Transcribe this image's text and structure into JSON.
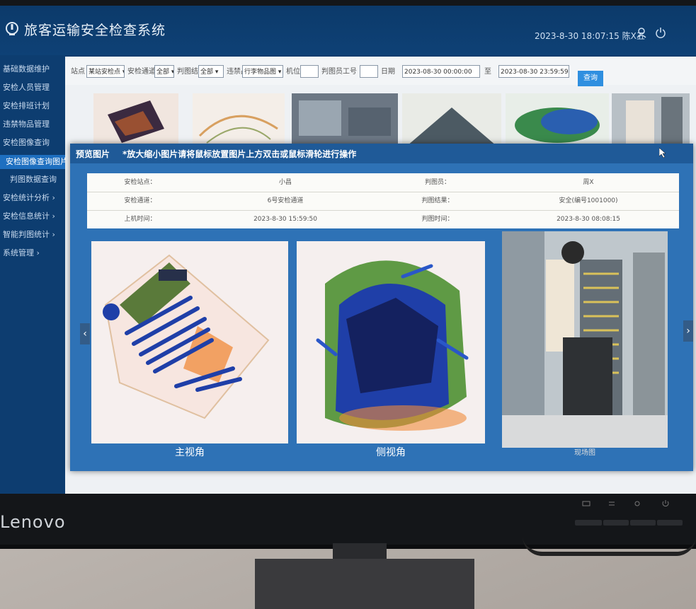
{
  "app": {
    "title": "旅客运输安全检查系统",
    "datetime": "2023-8-30 18:07:15",
    "user": "陈X五"
  },
  "sidebar": {
    "items": [
      {
        "label": "基础数据维护",
        "active": false
      },
      {
        "label": "安检人员管理",
        "active": false
      },
      {
        "label": "安检排班计划",
        "active": false
      },
      {
        "label": "违禁物品管理",
        "active": false
      },
      {
        "label": "安检图像查询",
        "active": false
      },
      {
        "label": "安检图像查询图片",
        "active": true
      },
      {
        "label": "判图数据查询",
        "active": false
      },
      {
        "label": "安检统计分析 ›",
        "active": false
      },
      {
        "label": "安检信息统计 ›",
        "active": false
      },
      {
        "label": "智能判图统计 ›",
        "active": false
      },
      {
        "label": "系统管理 ›",
        "active": false
      }
    ]
  },
  "filters": {
    "f1_label": "站点",
    "f1_value": "某站安检点 ▾",
    "f2_label": "安检通道",
    "f2_value": "全部 ▾",
    "f3_label": "判图结果",
    "f3_value": "全部 ▾",
    "f4_label": "违禁品",
    "f4_value": "行李物品图 ▾",
    "f5_label": "机位",
    "f6_label": "判图员工号",
    "f7_label": "日期",
    "start_date": "2023-08-30 00:00:00",
    "to_label": "至",
    "end_date": "2023-08-30 23:59:59",
    "search_label": "查询"
  },
  "modal": {
    "title": "预览图片",
    "hint": "*放大缩小图片请将鼠标放置图片上方双击或鼠标滑轮进行操作",
    "info_rows": [
      [
        "安检站点：",
        "小昌",
        "判图员：",
        "周X"
      ],
      [
        "安检通道：",
        "6号安检通道",
        "判图结果：",
        "安全(编号1001000)"
      ],
      [
        "上机时间：",
        "2023-8-30 15:59:50",
        "判图时间：",
        "2023-8-30 08:08:15"
      ]
    ],
    "captions": {
      "main_view": "主视角",
      "side_view": "侧视角",
      "camera_view": "现场图"
    },
    "prev_arrow": "‹",
    "next_arrow": "›"
  },
  "monitor": {
    "brand": "Lenovo"
  },
  "colors": {
    "topbar": "#0e4176",
    "sidebar": "#0d3d70",
    "active_item": "#1e6fc0",
    "modal_frame": "#2e72b6",
    "xray_blue": "#1f3fa8",
    "xray_orange": "#f08a3a",
    "xray_green": "#5a9a3a"
  }
}
